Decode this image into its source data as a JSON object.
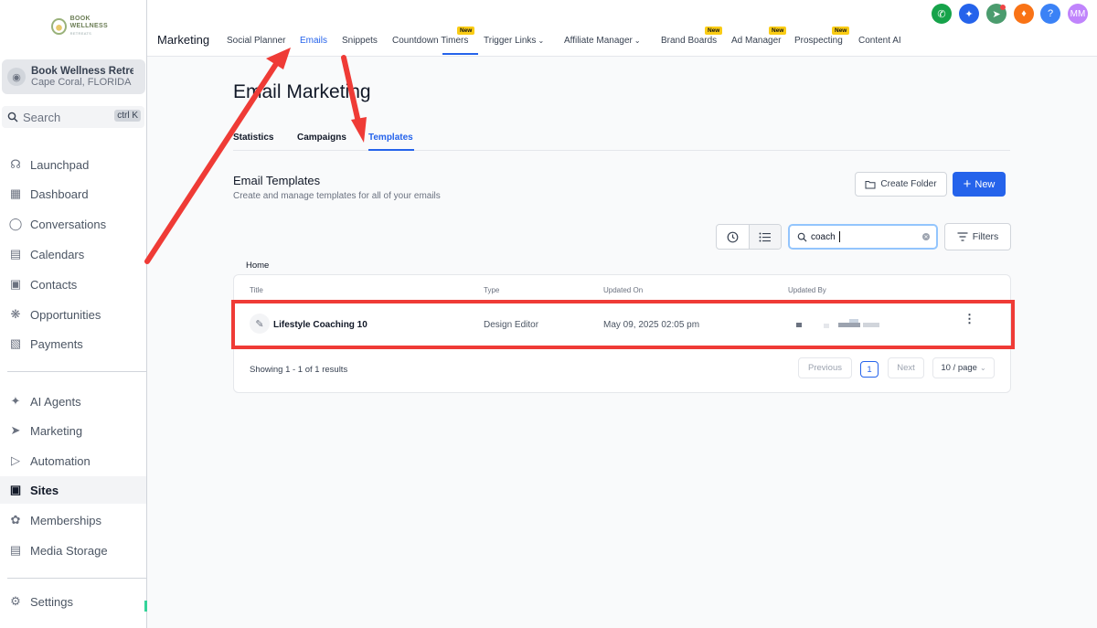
{
  "sidebar": {
    "logo": {
      "line1": "BOOK WELLNESS",
      "line2": "RETREATS"
    },
    "account": {
      "name": "Book Wellness Retre...",
      "location": "Cape Coral, FLORIDA"
    },
    "search": {
      "label": "Search",
      "shortcut": "ctrl K"
    },
    "items": [
      {
        "label": "Launchpad",
        "icon": "rocket-icon"
      },
      {
        "label": "Dashboard",
        "icon": "grid-icon"
      },
      {
        "label": "Conversations",
        "icon": "chat-icon"
      },
      {
        "label": "Calendars",
        "icon": "calendar-icon"
      },
      {
        "label": "Contacts",
        "icon": "contacts-icon"
      },
      {
        "label": "Opportunities",
        "icon": "opportunities-icon"
      },
      {
        "label": "Payments",
        "icon": "payments-icon"
      },
      {
        "label": "AI Agents",
        "icon": "sparkle-icon"
      },
      {
        "label": "Marketing",
        "icon": "send-icon"
      },
      {
        "label": "Automation",
        "icon": "automation-icon"
      },
      {
        "label": "Sites",
        "icon": "sites-icon",
        "active": true
      },
      {
        "label": "Memberships",
        "icon": "award-icon"
      },
      {
        "label": "Media Storage",
        "icon": "image-icon"
      },
      {
        "label": "Settings",
        "icon": "gear-icon"
      }
    ]
  },
  "topbar": {
    "section": "Marketing",
    "nav": [
      {
        "label": "Social Planner"
      },
      {
        "label": "Emails",
        "active": true
      },
      {
        "label": "Snippets"
      },
      {
        "label": "Countdown Timers",
        "badge": "New"
      },
      {
        "label": "Trigger Links",
        "dropdown": true
      },
      {
        "label": "Affiliate Manager",
        "dropdown": true
      },
      {
        "label": "Brand Boards",
        "badge": "New"
      },
      {
        "label": "Ad Manager",
        "badge": "New"
      },
      {
        "label": "Prospecting",
        "badge": "New"
      },
      {
        "label": "Content AI"
      }
    ],
    "avatar_initials": "MM",
    "help": "?",
    "colors": {
      "phone": "#16a34a",
      "magic": "#2563eb",
      "megaphone": "#4b9c6e",
      "bell": "#f97316",
      "help": "#3b82f6",
      "avatar": "#c084fc"
    }
  },
  "main": {
    "title": "Email Marketing",
    "tabs": [
      {
        "label": "Statistics"
      },
      {
        "label": "Campaigns"
      },
      {
        "label": "Templates",
        "active": true
      }
    ],
    "section_title": "Email Templates",
    "section_subtitle": "Create and manage templates for all of your emails",
    "create_folder": "Create Folder",
    "new_button": "New",
    "search_value": "coach",
    "filters": "Filters",
    "breadcrumb": "Home",
    "table": {
      "columns": [
        "Title",
        "Type",
        "Updated On",
        "Updated By"
      ],
      "rows": [
        {
          "title": "Lifestyle Coaching 10",
          "type": "Design Editor",
          "updated_on": "May 09, 2025 02:05 pm",
          "updated_by": ""
        }
      ]
    },
    "pagination": {
      "showing": "Showing 1 - 1 of 1 results",
      "previous": "Previous",
      "page": "1",
      "next": "Next",
      "page_size": "10 / page"
    }
  },
  "annotation_color": "#ef3b36"
}
